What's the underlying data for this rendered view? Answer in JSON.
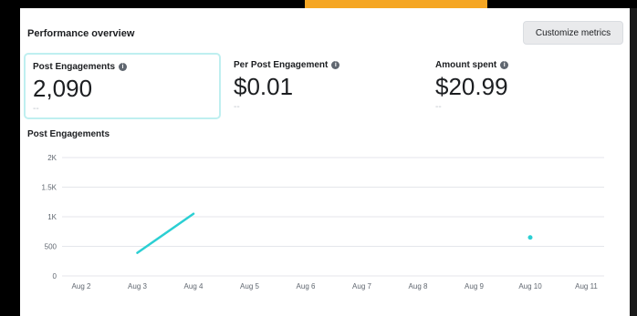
{
  "panel": {
    "title": "Performance overview",
    "customize_label": "Customize metrics"
  },
  "metrics": [
    {
      "label": "Post Engagements",
      "value": "2,090",
      "sub": "--",
      "selected": true
    },
    {
      "label": "Per Post Engagement",
      "value": "$0.01",
      "sub": "--",
      "selected": false
    },
    {
      "label": "Amount spent",
      "value": "$20.99",
      "sub": "--",
      "selected": false
    }
  ],
  "colors": {
    "accent_strip": "#f5a623",
    "series": "#2bcfd3",
    "selected_border": "#bfeff0"
  },
  "icons": {
    "info": "info-icon"
  },
  "chart_data": {
    "type": "line",
    "title": "Post Engagements",
    "x": [
      "Aug 2",
      "Aug 3",
      "Aug 4",
      "Aug 5",
      "Aug 6",
      "Aug 7",
      "Aug 8",
      "Aug 9",
      "Aug 10",
      "Aug 11"
    ],
    "y_ticks": [
      "2K",
      "1.5K",
      "1K",
      "500",
      "0"
    ],
    "ylim": [
      0,
      2000
    ],
    "grid": true,
    "series": [
      {
        "values": [
          null,
          390,
          1050,
          null,
          null,
          null,
          null,
          null,
          650,
          null
        ]
      }
    ]
  }
}
